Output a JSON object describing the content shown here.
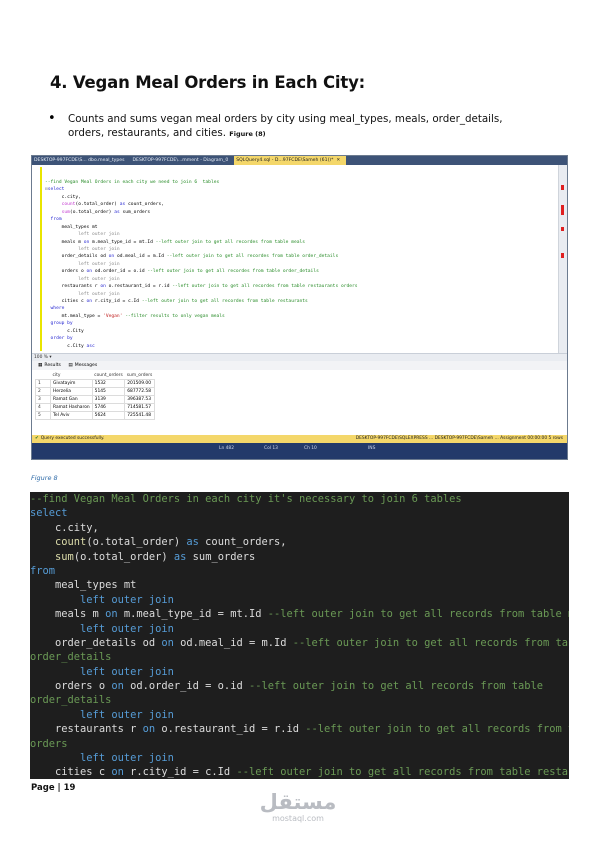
{
  "heading": "4. Vegan Meal Orders in Each City:",
  "bullet": {
    "text": "Counts and sums vegan meal orders by city using meal_types, meals, order_details, orders, restaurants, and cities.",
    "figure_ref": "Figure (8)"
  },
  "ssms": {
    "tabs": [
      {
        "label": "DESKTOP-997FCDE\\S... dbo.meal_types",
        "active": false
      },
      {
        "label": "DESKTOP-997FCDE\\...mment - Diagram_0",
        "active": false
      },
      {
        "label": "SQLQuery4.sql - D...97FCDE\\Sameh (61))*",
        "active": true
      }
    ],
    "code_lines": [
      [
        [
          "cm",
          "--find Vegan Meal Orders in each city we need to join 6  tables"
        ]
      ],
      [
        [
          "s-gr",
          "⊟"
        ],
        [
          "kw",
          "select"
        ]
      ],
      [
        [
          "",
          "      c.city,"
        ]
      ],
      [
        [
          "",
          "      "
        ],
        [
          "fn",
          "count"
        ],
        [
          "",
          "(o.total_order) "
        ],
        [
          "kw",
          "as"
        ],
        [
          "",
          " count_orders,"
        ]
      ],
      [
        [
          "",
          "      "
        ],
        [
          "fn",
          "sum"
        ],
        [
          "",
          "(o.total_order) "
        ],
        [
          "kw",
          "as"
        ],
        [
          "",
          " sum_orders"
        ]
      ],
      [
        [
          "kw",
          "  from"
        ]
      ],
      [
        [
          "",
          "      meal_types mt"
        ]
      ],
      [
        [
          "gr",
          "            left outer join"
        ]
      ],
      [
        [
          "",
          "      meals m "
        ],
        [
          "kw",
          "on"
        ],
        [
          "",
          " m.meal_type_id = mt.Id "
        ],
        [
          "cm",
          "--left outer join to get all recordes from table meals"
        ]
      ],
      [
        [
          "gr",
          "            left outer join"
        ]
      ],
      [
        [
          "",
          "      order_details od "
        ],
        [
          "kw",
          "on"
        ],
        [
          "",
          " od.meal_id = m.Id "
        ],
        [
          "cm",
          "--left outer join to get all recordes from table order_details"
        ]
      ],
      [
        [
          "gr",
          "            left outer join"
        ]
      ],
      [
        [
          "",
          "      orders o "
        ],
        [
          "kw",
          "on"
        ],
        [
          "",
          " od.order_id = o.id "
        ],
        [
          "cm",
          "--left outer join to get all recordes from table order_details"
        ]
      ],
      [
        [
          "gr",
          "            left outer join"
        ]
      ],
      [
        [
          "",
          "      restaurants r "
        ],
        [
          "kw",
          "on"
        ],
        [
          "",
          " o.restaurant_id = r.id "
        ],
        [
          "cm",
          "--left outer join to get all recordes from table restaurants orders"
        ]
      ],
      [
        [
          "gr",
          "            left outer join"
        ]
      ],
      [
        [
          "",
          "      cities c "
        ],
        [
          "kw",
          "on"
        ],
        [
          "",
          " r.city_id = c.Id "
        ],
        [
          "cm",
          "--left outer join to get all recordes from table restaurants"
        ]
      ],
      [
        [
          "kw",
          "  where"
        ]
      ],
      [
        [
          "",
          "      mt.meal_type = "
        ],
        [
          "str",
          "'Vegan'"
        ],
        [
          "",
          " "
        ],
        [
          "cm",
          "--filter results to only vegan meals"
        ]
      ],
      [
        [
          "kw",
          "  group by"
        ]
      ],
      [
        [
          "",
          "        c.City"
        ]
      ],
      [
        [
          "kw",
          "  order by"
        ]
      ],
      [
        [
          "",
          "        c.City "
        ],
        [
          "kw",
          "asc"
        ],
        [
          ";"
        ]
      ]
    ],
    "zoom": "100 %",
    "results_tab": "Results",
    "messages_tab": "Messages",
    "grid_headers": [
      "city",
      "count_orders",
      "sum_orders"
    ],
    "grid_rows": [
      [
        "1",
        "Givatayim",
        "1532",
        "201509.00"
      ],
      [
        "2",
        "Herzelia",
        "5145",
        "687772.58"
      ],
      [
        "3",
        "Ramat Gan",
        "3139",
        "396387.53"
      ],
      [
        "4",
        "Ramat Hasharon",
        "5746",
        "714581.57"
      ],
      [
        "5",
        "Tel Aviv",
        "5624",
        "725541.48"
      ]
    ],
    "status_message": "Query executed successfully.",
    "status_right": "DESKTOP-997FCDE\\SQLEXPRESS ...   DESKTOP-997FCDE\\Sameh ...   Assignment   00:00:00   5 rows",
    "ln": "Ln 482",
    "col": "Col 13",
    "ch": "Ch 10",
    "ins": "INS"
  },
  "caption": "Figure 8",
  "dark_code": [
    [
      [
        "cm",
        "--find Vegan Meal Orders in each city it's necessary to join 6 tables"
      ]
    ],
    [
      [
        "kw",
        "select"
      ]
    ],
    [
      [
        "",
        "    c.city,"
      ]
    ],
    [
      [
        "",
        "    "
      ],
      [
        "fn",
        "count"
      ],
      [
        "",
        "(o.total_order) "
      ],
      [
        "kw",
        "as"
      ],
      [
        "",
        " count_orders,"
      ]
    ],
    [
      [
        "",
        "    "
      ],
      [
        "fn",
        "sum"
      ],
      [
        "",
        "(o.total_order) "
      ],
      [
        "kw",
        "as"
      ],
      [
        "",
        " sum_orders"
      ]
    ],
    [
      [
        "kw",
        "from"
      ]
    ],
    [
      [
        "",
        "    meal_types mt"
      ]
    ],
    [
      [
        "kw",
        "        left outer join"
      ]
    ],
    [
      [
        "",
        "    meals m "
      ],
      [
        "kw",
        "on"
      ],
      [
        "",
        " m.meal_type_id = mt.Id "
      ],
      [
        "cm",
        "--left outer join to get all records from table meals"
      ]
    ],
    [
      [
        "kw",
        "        left outer join"
      ]
    ],
    [
      [
        "",
        "    order_details od "
      ],
      [
        "kw",
        "on"
      ],
      [
        "",
        " od.meal_id = m.Id "
      ],
      [
        "cm",
        "--left outer join to get all records from table"
      ]
    ],
    [
      [
        "cm",
        "order_details"
      ]
    ],
    [
      [
        "kw",
        "        left outer join"
      ]
    ],
    [
      [
        "",
        "    orders o "
      ],
      [
        "kw",
        "on"
      ],
      [
        "",
        " od.order_id = o.id "
      ],
      [
        "cm",
        "--left outer join to get all records from table"
      ]
    ],
    [
      [
        "cm",
        "order_details"
      ]
    ],
    [
      [
        "kw",
        "        left outer join"
      ]
    ],
    [
      [
        "",
        "    restaurants r "
      ],
      [
        "kw",
        "on"
      ],
      [
        "",
        " o.restaurant_id = r.id "
      ],
      [
        "cm",
        "--left outer join to get all records from table"
      ]
    ],
    [
      [
        "cm",
        "orders"
      ]
    ],
    [
      [
        "kw",
        "        left outer join"
      ]
    ],
    [
      [
        "",
        "    cities c "
      ],
      [
        "kw",
        "on"
      ],
      [
        "",
        " r.city_id = c.Id "
      ],
      [
        "cm",
        "--left outer join to get all records from table restaurants"
      ]
    ]
  ],
  "footer": "Page | 19",
  "watermark": {
    "arabic": "مستقل",
    "latin": "mostaql.com"
  }
}
